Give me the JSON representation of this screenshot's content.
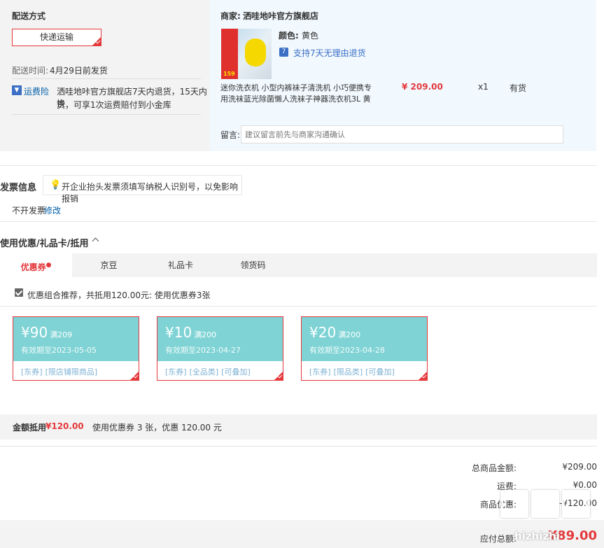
{
  "shipping": {
    "title": "配送方式",
    "method": "快递运输",
    "time_label": "配送时间:",
    "time_value": "4月29日前发货",
    "insurance_label": "运费险",
    "insurance_text_1": "洒哇地咔官方旗舰店7天内退货，15天内换",
    "insurance_text_2": "货，可享1次运费赔付到小金库"
  },
  "merchant": {
    "label": "商家:",
    "name": "洒哇地咔官方旗舰店",
    "color_label": "颜色:",
    "color_value": "黄色",
    "return_icon_glyph": "7",
    "return_policy": "支持7天无理由退货",
    "product_name_1": "迷你洗衣机 小型内裤袜子清洗机 小巧便携专",
    "product_name_2": "用洗袜蓝光除菌懒人洗袜子神器洗衣机3L 黄",
    "price": "¥ 209.00",
    "qty": "x1",
    "stock": "有货",
    "remark_label": "留言:",
    "remark_placeholder": "建议留言前先与商家沟通确认",
    "thumb_badge": "159"
  },
  "invoice": {
    "title": "发票信息",
    "tip": "开企业抬头发票须填写纳税人识别号，以免影响报销",
    "status": "不开发票",
    "edit": "修改"
  },
  "discount": {
    "title": "使用优惠/礼品卡/抵用",
    "tabs": [
      "优惠券",
      "京豆",
      "礼品卡",
      "领货码"
    ],
    "recommend_text": "优惠组合推荐，共抵用120.00元: 使用优惠券3张",
    "coupons": [
      {
        "amount": "¥90",
        "cond": "满209",
        "expiry": "有效期至2023-05-05",
        "tags": [
          "[东券]",
          "[限店铺限商品]"
        ]
      },
      {
        "amount": "¥10",
        "cond": "满200",
        "expiry": "有效期至2023-04-27",
        "tags": [
          "[东券]",
          "[全品类]",
          "[可叠加]"
        ]
      },
      {
        "amount": "¥20",
        "cond": "满200",
        "expiry": "有效期至2023-04-28",
        "tags": [
          "[东券]",
          "[限品类]",
          "[可叠加]"
        ]
      }
    ],
    "summary_label": "金额抵用",
    "summary_amount": "¥120.00",
    "summary_detail": "使用优惠券 3 张，优惠 120.00 元"
  },
  "totals": {
    "goods_label": "总商品金额:",
    "goods_value": "¥209.00",
    "freight_label": "运费:",
    "freight_value": "¥0.00",
    "discount_label": "商品优惠:",
    "discount_value": "-¥120.00",
    "payable_label": "应付总额:",
    "payable_value": "¥89.00"
  },
  "watermark": "值 什么值得买 · hizhizhi",
  "colors": {
    "accent": "#e4393c",
    "coupon": "#7fd3d5",
    "link": "#005ea7"
  }
}
